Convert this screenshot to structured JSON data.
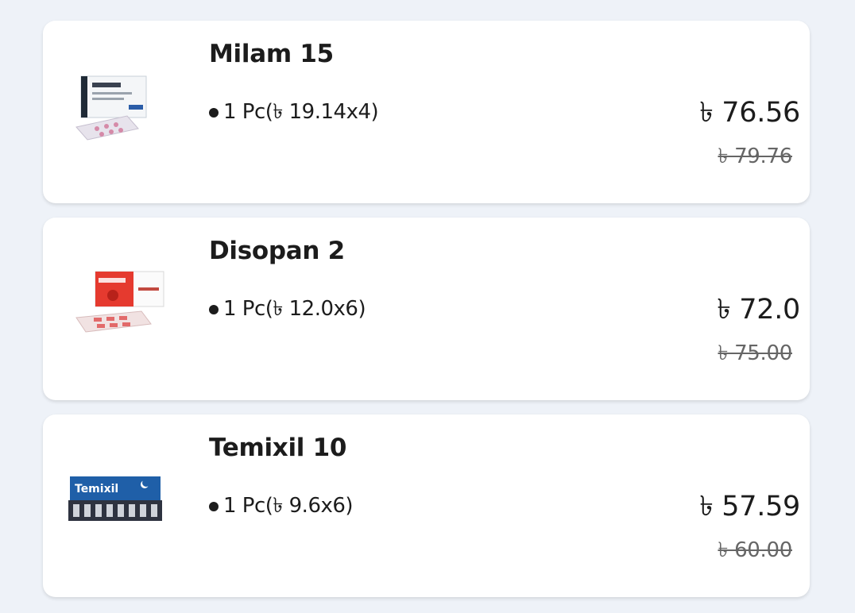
{
  "products": [
    {
      "name": "Milam 15",
      "pack_text": "1 Pc(৳ 19.14x4)",
      "price": "৳ 76.56",
      "old_price": "৳ 79.76",
      "image_name": "milam-15-product-image"
    },
    {
      "name": "Disopan 2",
      "pack_text": "1 Pc(৳ 12.0x6)",
      "price": "৳ 72.0",
      "old_price": "৳ 75.00",
      "image_name": "disopan-2-product-image"
    },
    {
      "name": "Temixil 10",
      "pack_text": "1 Pc(৳ 9.6x6)",
      "price": "৳ 57.59",
      "old_price": "৳ 60.00",
      "image_name": "temixil-10-product-image",
      "image_brand_text": "Temixil"
    }
  ]
}
